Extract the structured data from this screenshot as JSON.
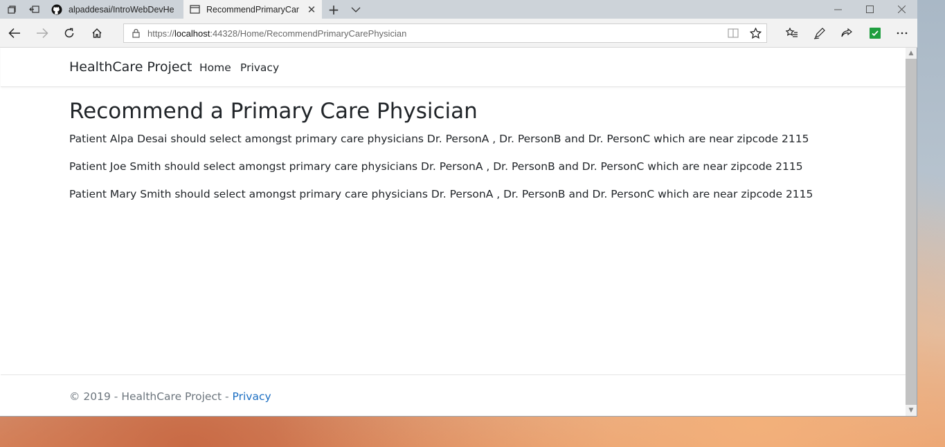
{
  "browser": {
    "tabs": [
      {
        "label": "alpaddesai/IntroWebDevHe",
        "icon": "github-icon",
        "active": false
      },
      {
        "label": "RecommendPrimaryCar",
        "icon": "page-icon",
        "active": true
      }
    ],
    "address_bar": {
      "url_prefix": "https://",
      "url_host": "localhost",
      "url_rest": ":44328/Home/RecommendPrimaryCarePhysician"
    }
  },
  "site": {
    "brand": "HealthCare Project",
    "nav": [
      {
        "label": "Home"
      },
      {
        "label": "Privacy"
      }
    ]
  },
  "main": {
    "heading": "Recommend a Primary Care Physician",
    "recommendations": [
      "Patient Alpa Desai should select amongst primary care physicians Dr. PersonA , Dr. PersonB and Dr. PersonC which are near zipcode 2115",
      "Patient Joe Smith should select amongst primary care physicians Dr. PersonA , Dr. PersonB and Dr. PersonC which are near zipcode 2115",
      "Patient Mary Smith should select amongst primary care physicians Dr. PersonA , Dr. PersonB and Dr. PersonC which are near zipcode 2115"
    ]
  },
  "footer": {
    "text": "© 2019 - HealthCare Project - ",
    "link": "Privacy"
  },
  "colors": {
    "link": "#1b6ec2",
    "text": "#212529",
    "muted": "#6c757d"
  }
}
